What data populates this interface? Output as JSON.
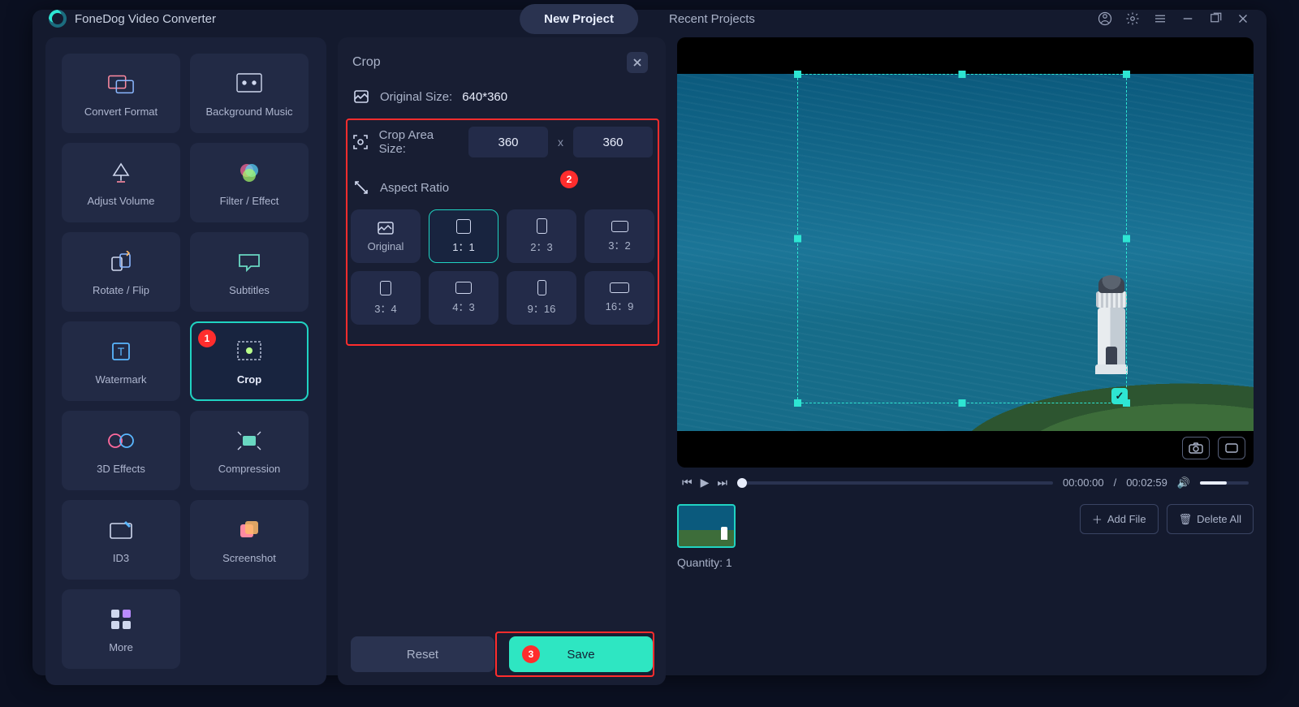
{
  "app_name": "FoneDog Video Converter",
  "tabs": {
    "new_project": "New Project",
    "recent_projects": "Recent Projects"
  },
  "tools": [
    {
      "id": "convert-format",
      "label": "Convert Format"
    },
    {
      "id": "background-music",
      "label": "Background Music"
    },
    {
      "id": "adjust-volume",
      "label": "Adjust Volume"
    },
    {
      "id": "filter-effect",
      "label": "Filter / Effect"
    },
    {
      "id": "rotate-flip",
      "label": "Rotate / Flip"
    },
    {
      "id": "subtitles",
      "label": "Subtitles"
    },
    {
      "id": "watermark",
      "label": "Watermark"
    },
    {
      "id": "crop",
      "label": "Crop"
    },
    {
      "id": "3d-effects",
      "label": "3D Effects"
    },
    {
      "id": "compression",
      "label": "Compression"
    },
    {
      "id": "id3",
      "label": "ID3"
    },
    {
      "id": "screenshot",
      "label": "Screenshot"
    },
    {
      "id": "more",
      "label": "More"
    }
  ],
  "crop": {
    "title": "Crop",
    "original_size_label": "Original Size:",
    "original_size_value": "640*360",
    "crop_area_label": "Crop Area Size:",
    "width": "360",
    "height": "360",
    "aspect_ratio_label": "Aspect Ratio",
    "ratios": [
      {
        "id": "original",
        "label": "Original"
      },
      {
        "id": "1-1",
        "label": "1：1"
      },
      {
        "id": "2-3",
        "label": "2：3"
      },
      {
        "id": "3-2",
        "label": "3：2"
      },
      {
        "id": "3-4",
        "label": "3：4"
      },
      {
        "id": "4-3",
        "label": "4：3"
      },
      {
        "id": "9-16",
        "label": "9：16"
      },
      {
        "id": "16-9",
        "label": "16：9"
      }
    ],
    "selected_ratio": "1-1",
    "reset_label": "Reset",
    "save_label": "Save"
  },
  "player": {
    "current_time": "00:00:00",
    "duration": "00:02:59",
    "time_sep": " / "
  },
  "filebar": {
    "add_file_label": "Add File",
    "delete_all_label": "Delete All",
    "quantity_label": "Quantity:",
    "quantity_value": "1"
  },
  "callouts": {
    "c1": "1",
    "c2": "2",
    "c3": "3"
  }
}
